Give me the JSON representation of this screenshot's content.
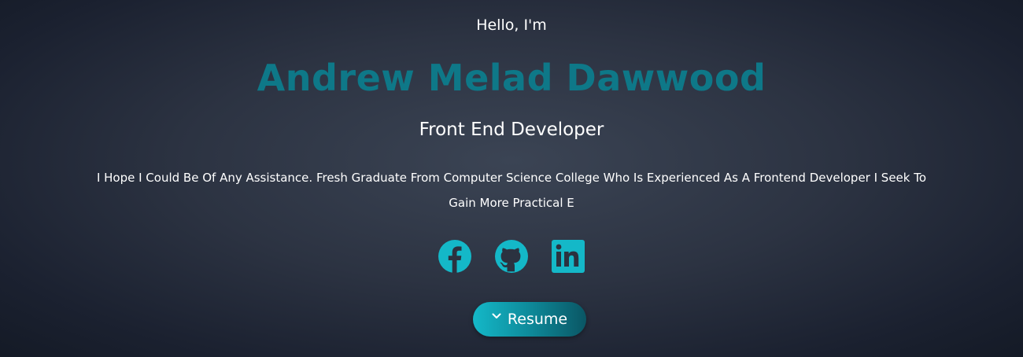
{
  "hero": {
    "greeting": "Hello, I'm",
    "name": "Andrew Melad Dawwood",
    "role": "Front End Developer",
    "bio": "I Hope I Could Be Of Any Assistance. Fresh Graduate From Computer Science College Who Is Experienced As A Frontend Developer I Seek To Gain More Practical E"
  },
  "socials": [
    {
      "icon": "facebook-icon"
    },
    {
      "icon": "github-icon"
    },
    {
      "icon": "linkedin-icon"
    }
  ],
  "resume": {
    "label": "Resume",
    "icon": "chevron-down-icon"
  },
  "colors": {
    "accent": "#14b8c8",
    "name": "#0e7888",
    "background": "#2c3342"
  }
}
